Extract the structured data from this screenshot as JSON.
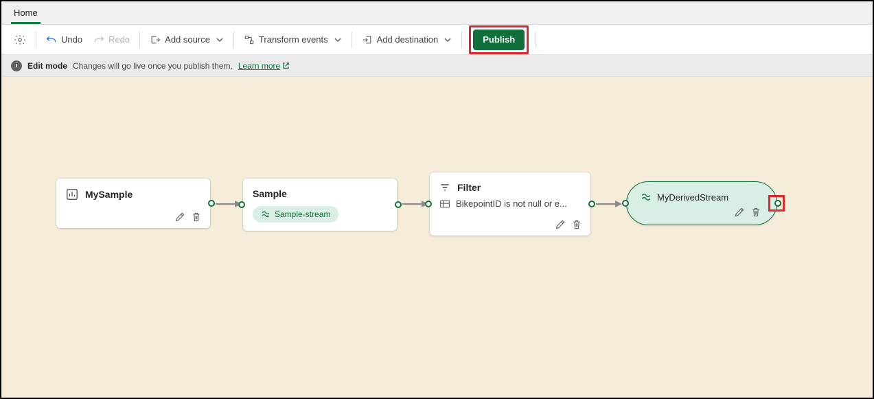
{
  "tabs": {
    "home": "Home"
  },
  "toolbar": {
    "undo": "Undo",
    "redo": "Redo",
    "add_source": "Add source",
    "transform": "Transform events",
    "add_dest": "Add destination",
    "publish": "Publish"
  },
  "infobar": {
    "mode": "Edit mode",
    "msg": "Changes will go live once you publish them.",
    "learn": "Learn more"
  },
  "nodes": {
    "source": {
      "title": "MySample"
    },
    "sample": {
      "title": "Sample",
      "chip": "Sample-stream"
    },
    "filter": {
      "title": "Filter",
      "expr": "BikepointID is not null or e..."
    },
    "dest": {
      "title": "MyDerivedStream"
    }
  }
}
